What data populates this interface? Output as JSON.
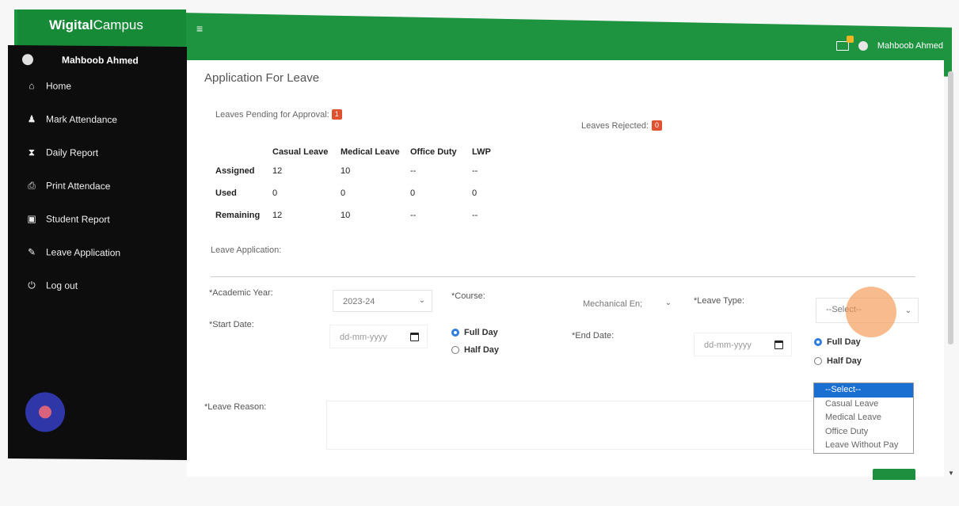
{
  "app": {
    "brand_bold": "Wigital",
    "brand_rest": "Campus",
    "menu_glyph": "≡"
  },
  "header": {
    "user_name": "Mahboob Ahmed"
  },
  "sidebar": {
    "user_name": "Mahboob Ahmed",
    "items": [
      {
        "label": "Home",
        "icon": "home-icon",
        "glyph": "⌂"
      },
      {
        "label": "Mark Attendance",
        "icon": "user-icon",
        "glyph": "♟"
      },
      {
        "label": "Daily Report",
        "icon": "hourglass-icon",
        "glyph": "⧗"
      },
      {
        "label": "Print Attendace",
        "icon": "print-icon",
        "glyph": "⎙"
      },
      {
        "label": "Student Report",
        "icon": "report-icon",
        "glyph": "▣"
      },
      {
        "label": "Leave Application",
        "icon": "edit-icon",
        "glyph": "✎"
      },
      {
        "label": "Log out",
        "icon": "power-icon",
        "glyph": "⏻"
      }
    ]
  },
  "page": {
    "title": "Application For Leave",
    "pending_label": "Leaves Pending for Approval:",
    "pending_count": "1",
    "rejected_label": "Leaves Rejected:",
    "rejected_count": "0",
    "table": {
      "headers": [
        "",
        "Casual Leave",
        "Medical Leave",
        "Office Duty",
        "LWP"
      ],
      "rows": [
        {
          "label": "Assigned",
          "values": [
            "12",
            "10",
            "--",
            "--"
          ]
        },
        {
          "label": "Used",
          "values": [
            "0",
            "0",
            "0",
            "0"
          ]
        },
        {
          "label": "Remaining",
          "values": [
            "12",
            "10",
            "--",
            "--"
          ]
        }
      ]
    },
    "leave_application_label": "Leave Application:"
  },
  "form": {
    "academic_year_label": "*Academic Year:",
    "academic_year_value": "2023-24",
    "course_label": "*Course:",
    "course_value": "Mechanical En;",
    "leave_type_label": "*Leave Type:",
    "leave_type_value": "--Select--",
    "start_date_label": "*Start Date:",
    "start_date_placeholder": "dd-mm-yyyy",
    "end_date_label": "*End Date:",
    "end_date_placeholder": "dd-mm-yyyy",
    "full_day": "Full Day",
    "half_day": "Half Day",
    "reason_label": "*Leave Reason:"
  },
  "dropdown": {
    "options": [
      "--Select--",
      "Casual Leave",
      "Medical Leave",
      "Office Duty",
      "Leave Without Pay"
    ]
  },
  "colors": {
    "accent": "#1e9440",
    "sidebar": "#0d0d0d",
    "badge": "#e0522f",
    "selected": "#1a6fd1"
  }
}
